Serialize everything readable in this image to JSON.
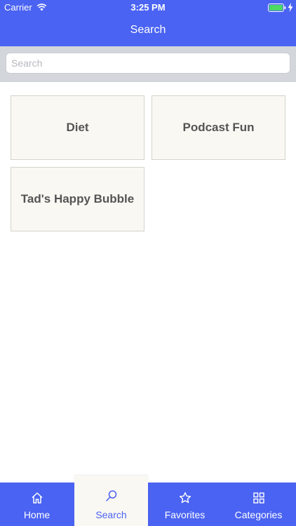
{
  "status": {
    "carrier": "Carrier",
    "time": "3:25 PM"
  },
  "nav": {
    "title": "Search"
  },
  "search": {
    "placeholder": "Search",
    "value": ""
  },
  "tiles": [
    {
      "label": "Diet"
    },
    {
      "label": "Podcast Fun"
    },
    {
      "label": "Tad's Happy Bubble"
    }
  ],
  "tabs": [
    {
      "label": "Home",
      "icon": "home-icon",
      "active": false
    },
    {
      "label": "Search",
      "icon": "search-icon",
      "active": true
    },
    {
      "label": "Favorites",
      "icon": "star-icon",
      "active": false
    },
    {
      "label": "Categories",
      "icon": "grid-icon",
      "active": false
    }
  ],
  "colors": {
    "accent": "#4a63f2",
    "tile_bg": "#f9f8f3",
    "searchbar_bg": "#d3d6db"
  }
}
